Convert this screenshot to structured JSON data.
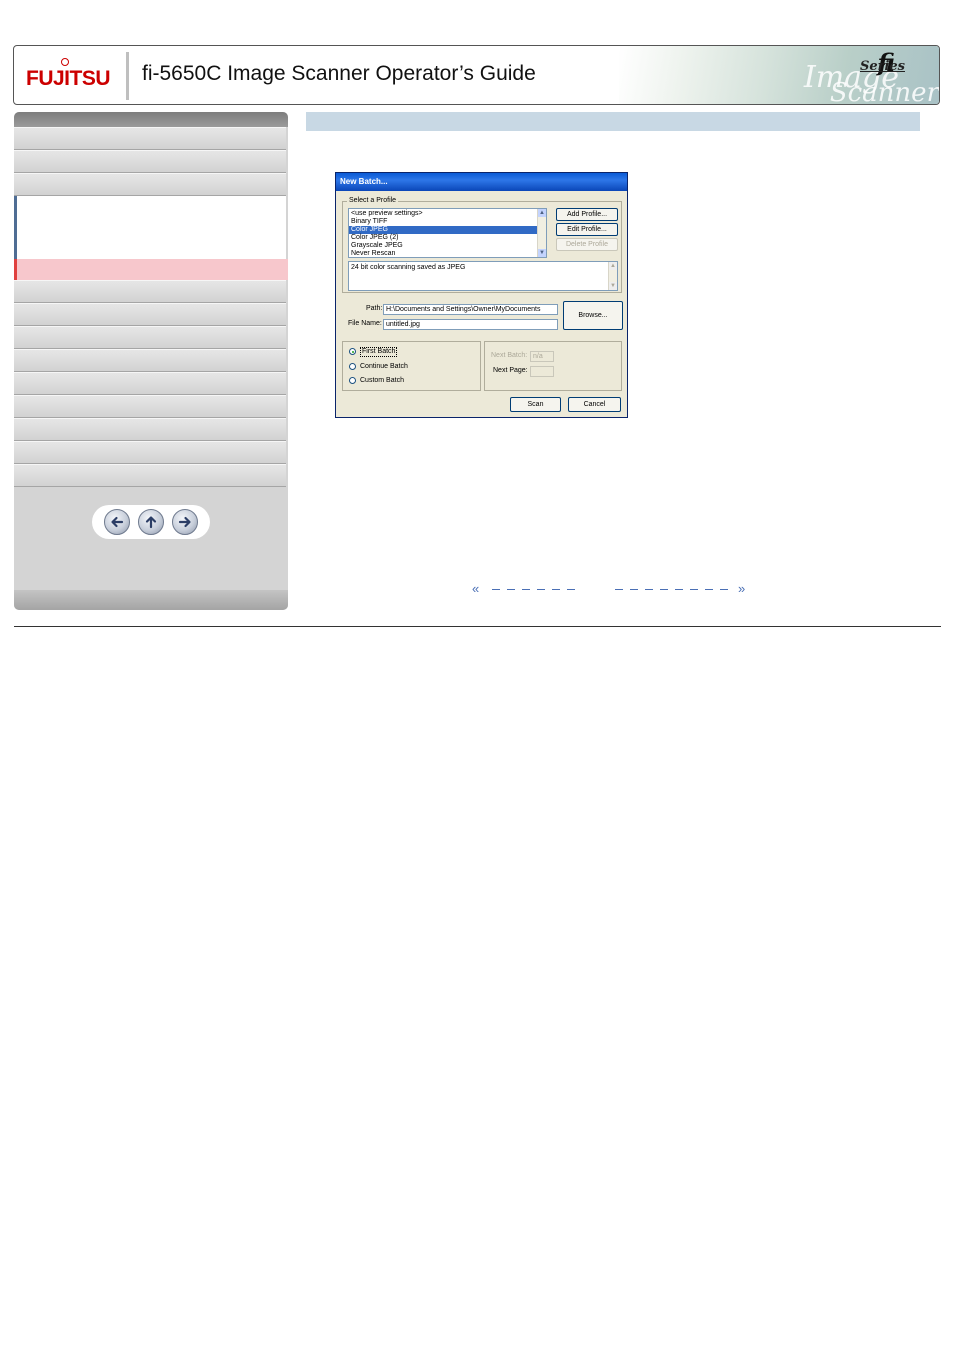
{
  "header": {
    "logo_text": "FUJITSU",
    "title": "fi-5650C Image Scanner Operator’s Guide",
    "series_mark": "fi",
    "series_text": "Series",
    "art_text_1": "Image",
    "art_text_2": "Scanner"
  },
  "dialog": {
    "title": "New Batch...",
    "profile_group_label": "Select a Profile",
    "profiles": [
      "<use preview settings>",
      "Binary TIFF",
      "Color JPEG",
      "Color JPEG (2)",
      "Grayscale JPEG",
      "Never Rescan"
    ],
    "selected_profile": "Color JPEG",
    "add_profile_label": "Add Profile...",
    "edit_profile_label": "Edit Profile...",
    "delete_profile_label": "Delete Profile",
    "description": "24 bit color scanning saved as JPEG",
    "path_label": "Path:",
    "path_value": "H:\\Documents and Settings\\Owner\\MyDocuments",
    "file_name_label": "File Name:",
    "file_name_value": "untitled.jpg",
    "browse_label": "Browse...",
    "batch_options": [
      "First Batch",
      "Continue Batch",
      "Custom Batch"
    ],
    "selected_batch_option": "First Batch",
    "next_batch_label": "Next Batch:",
    "next_batch_value": "n/a",
    "next_page_label": "Next Page:",
    "next_page_value": "",
    "scan_label": "Scan",
    "cancel_label": "Cancel"
  },
  "colors": {
    "logo_red": "#cc0000",
    "sidebar_current_bg": "#f7c7cc",
    "sidebar_current_marker": "#e0403f",
    "content_band": "#c8d8e4",
    "link_blue": "#4a6fb5"
  },
  "icons": {
    "nav_back": "arrow-left-icon",
    "nav_up": "arrow-up-icon",
    "nav_forward": "arrow-right-icon",
    "prev_page": "double-chevron-left-icon",
    "next_page": "double-chevron-right-icon"
  },
  "page_nav": {
    "prev_symbol": "«",
    "next_symbol": "»"
  }
}
